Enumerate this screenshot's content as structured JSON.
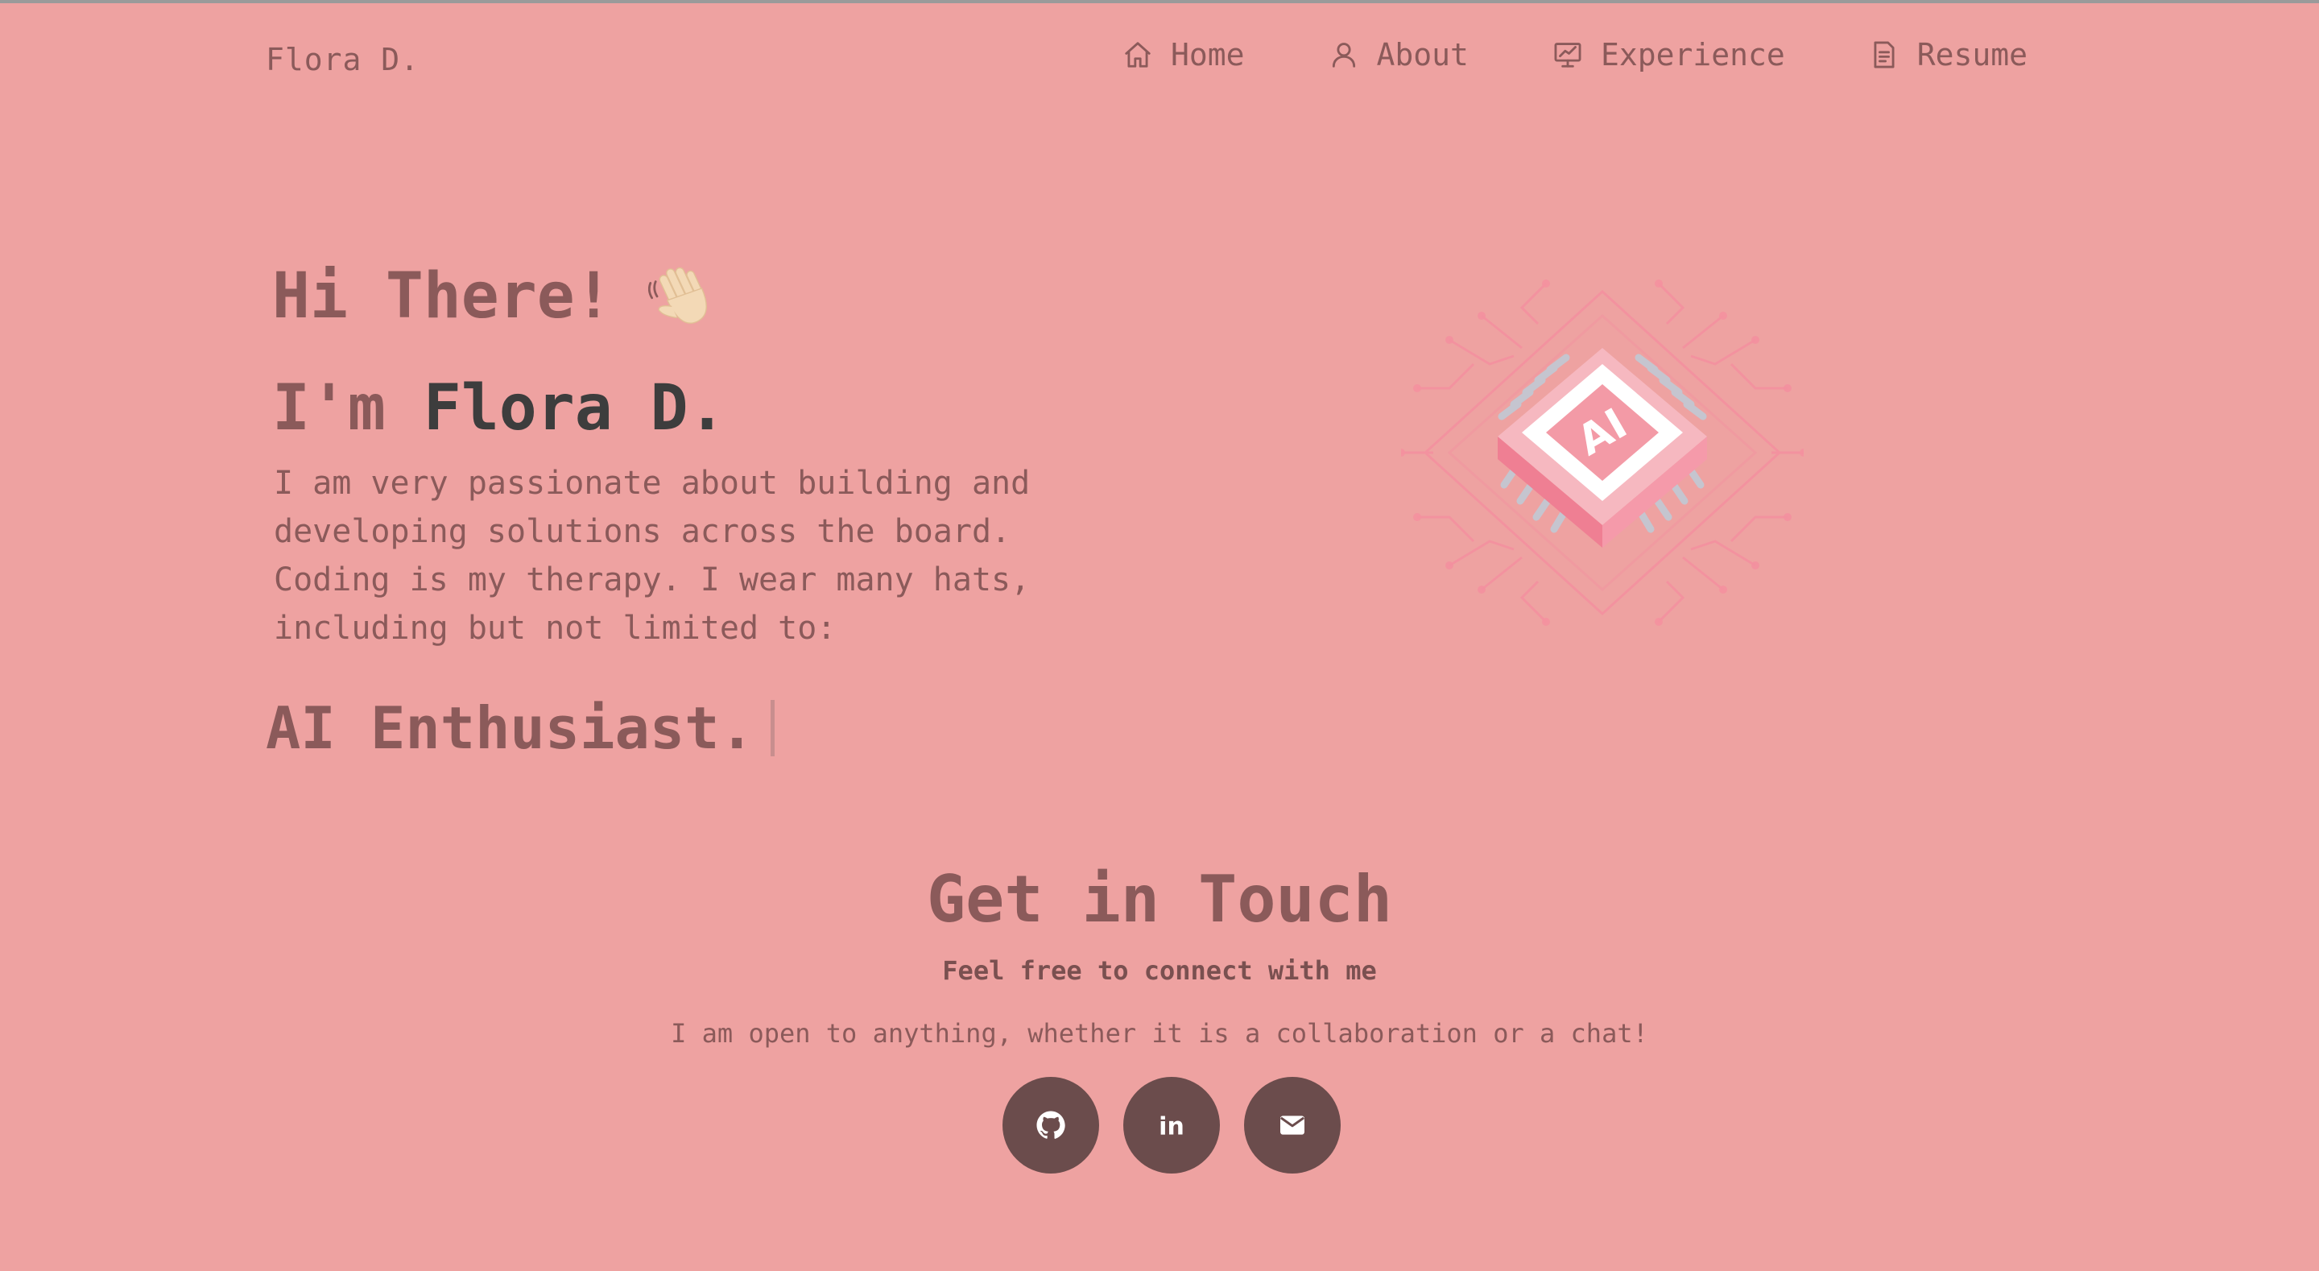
{
  "navbar": {
    "brand": "Flora D.",
    "items": [
      {
        "label": "Home",
        "icon": "home-icon"
      },
      {
        "label": "About",
        "icon": "user-icon"
      },
      {
        "label": "Experience",
        "icon": "presentation-icon"
      },
      {
        "label": "Resume",
        "icon": "document-icon"
      }
    ]
  },
  "hero": {
    "greeting": "Hi There!",
    "greeting_icon": "waving-hand-icon",
    "im_prefix": "I'm",
    "name": "Flora D.",
    "intro": "I am very passionate about building and developing solutions across the board. Coding is my therapy. I wear many hats, including but not limited to:",
    "role": "AI Enthusiast.",
    "illustration": "ai-chip-illustration",
    "illustration_label": "AI"
  },
  "contact": {
    "title": "Get in Touch",
    "subtitle": "Feel free to connect with me",
    "text": "I am open to anything, whether it is a collaboration or a chat!",
    "socials": [
      {
        "icon": "github-icon"
      },
      {
        "icon": "linkedin-icon",
        "label": "in"
      },
      {
        "icon": "mail-icon"
      }
    ]
  },
  "colors": {
    "background": "#eea2a1",
    "text": "#8b5a5a",
    "name": "#3d3d3d",
    "social_button": "#6b4c4c"
  }
}
